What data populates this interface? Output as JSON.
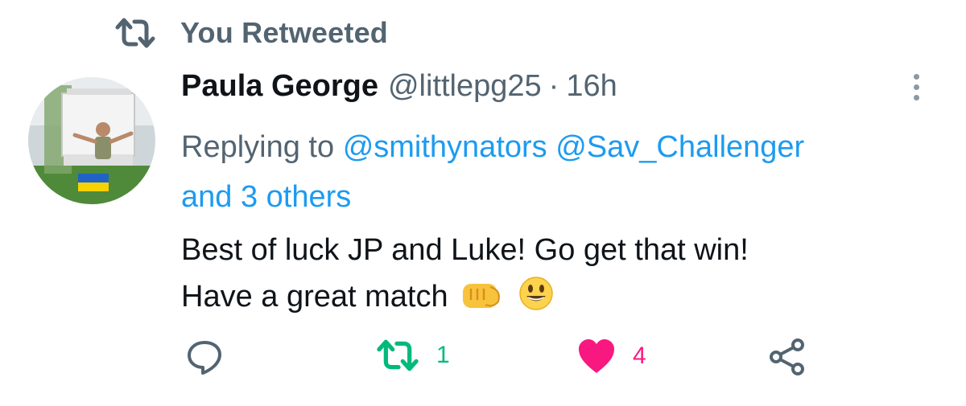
{
  "context": {
    "label": "You Retweeted",
    "icon": "retweet-icon"
  },
  "tweet": {
    "author_name": "Paula George",
    "author_handle": "@littlepg25",
    "separator": "·",
    "time": "16h",
    "replying_prefix": "Replying to",
    "mentions": [
      "@smithynators",
      "@Sav_Challenger"
    ],
    "others": "and 3 others",
    "text_line1": "Best of luck JP and Luke! Go get that win!",
    "text_line2": "Have a great match",
    "emojis": [
      "oncoming-fist",
      "grinning-face"
    ]
  },
  "actions": {
    "reply": {
      "icon": "reply-icon",
      "count": ""
    },
    "retweet": {
      "icon": "retweet-icon",
      "count": "1",
      "active_color": "#00ba7c"
    },
    "like": {
      "icon": "heart-icon",
      "count": "4",
      "active_color": "#f91880"
    },
    "share": {
      "icon": "share-icon"
    }
  },
  "colors": {
    "secondary_text": "#536471",
    "link": "#1d9bf0",
    "primary_text": "#0f1419"
  }
}
